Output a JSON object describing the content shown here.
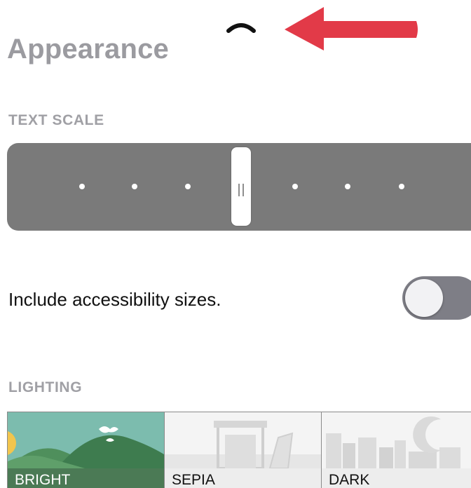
{
  "header": {
    "title": "Appearance",
    "collapse_icon": "chevron-up-icon",
    "annotation_icon": "red-arrow-left-icon",
    "annotation_color": "#e23a48"
  },
  "text_scale": {
    "section_label": "TEXT SCALE",
    "steps": 7,
    "selected_step": 4,
    "grip_icon": "drag-handle-icon"
  },
  "accessibility": {
    "label": "Include accessibility sizes.",
    "toggle_on": false
  },
  "lighting": {
    "section_label": "LIGHTING",
    "selected": "BRIGHT",
    "options": [
      {
        "label": "BRIGHT",
        "icon": "hills-icon"
      },
      {
        "label": "SEPIA",
        "icon": "room-icon"
      },
      {
        "label": "DARK",
        "icon": "moon-city-icon"
      }
    ]
  },
  "colors": {
    "heading_gray": "#9b9ba0",
    "slider_track": "#7a7a7a",
    "bright_label_bg": "#4b7a55",
    "bright_sky": "#7cbcae"
  }
}
